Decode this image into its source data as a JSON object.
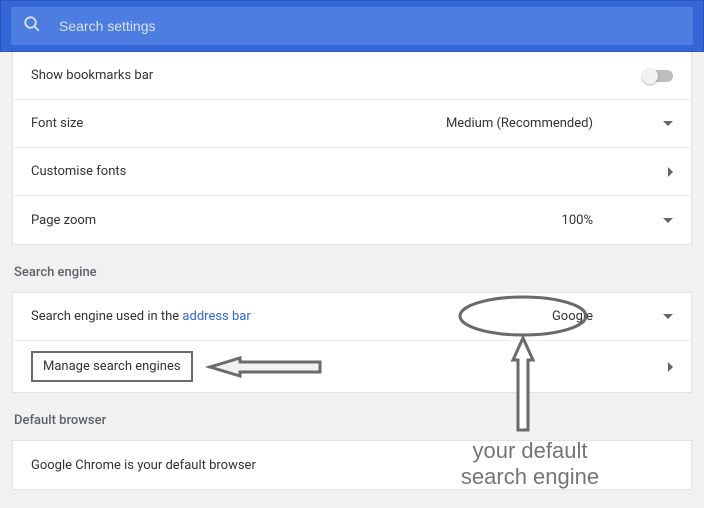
{
  "search": {
    "placeholder": "Search settings"
  },
  "appearance": {
    "bookmarks_label": "Show bookmarks bar",
    "font_size_label": "Font size",
    "font_size_value": "Medium (Recommended)",
    "customise_fonts_label": "Customise fonts",
    "page_zoom_label": "Page zoom",
    "page_zoom_value": "100%"
  },
  "search_engine": {
    "title": "Search engine",
    "row1_prefix": "Search engine used in the ",
    "row1_link": "address bar",
    "row1_value": "Google",
    "manage_label": "Manage search engines"
  },
  "default_browser": {
    "title": "Default browser",
    "message": "Google Chrome is your default browser"
  },
  "annotation": {
    "line1": "your default",
    "line2": "search engine"
  }
}
